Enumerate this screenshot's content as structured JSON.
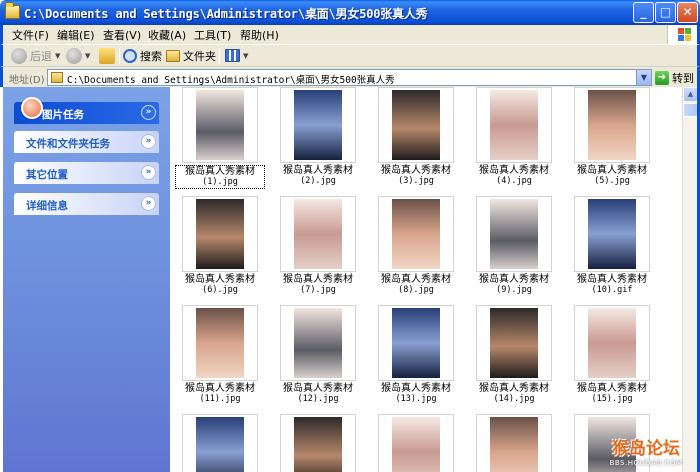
{
  "window": {
    "title": "C:\\Documents and Settings\\Administrator\\桌面\\男女500张真人秀",
    "buttons": {
      "minimize": "_",
      "maximize": "□",
      "close": "✕"
    }
  },
  "menu": [
    "文件(F)",
    "编辑(E)",
    "查看(V)",
    "收藏(A)",
    "工具(T)",
    "帮助(H)"
  ],
  "toolbar": {
    "back": "后退",
    "search": "搜索",
    "folders": "文件夹"
  },
  "address": {
    "label": "地址(D)",
    "value": "C:\\Documents and Settings\\Administrator\\桌面\\男女500张真人秀",
    "go": "转到"
  },
  "tasks": [
    "图片任务",
    "文件和文件夹任务",
    "其它位置",
    "详细信息"
  ],
  "files": [
    {
      "name": "猴岛真人秀素材",
      "ext": "(1).jpg",
      "selected": true
    },
    {
      "name": "猴岛真人秀素材",
      "ext": "(2).jpg"
    },
    {
      "name": "猴岛真人秀素材",
      "ext": "(3).jpg"
    },
    {
      "name": "猴岛真人秀素材",
      "ext": "(4).jpg"
    },
    {
      "name": "猴岛真人秀素材",
      "ext": "(5).jpg"
    },
    {
      "name": "猴岛真人秀素材",
      "ext": "(6).jpg"
    },
    {
      "name": "猴岛真人秀素材",
      "ext": "(7).jpg"
    },
    {
      "name": "猴岛真人秀素材",
      "ext": "(8).jpg"
    },
    {
      "name": "猴岛真人秀素材",
      "ext": "(9).jpg"
    },
    {
      "name": "猴岛真人秀素材",
      "ext": "(10).gif"
    },
    {
      "name": "猴岛真人秀素材",
      "ext": "(11).jpg"
    },
    {
      "name": "猴岛真人秀素材",
      "ext": "(12).jpg"
    },
    {
      "name": "猴岛真人秀素材",
      "ext": "(13).jpg"
    },
    {
      "name": "猴岛真人秀素材",
      "ext": "(14).jpg"
    },
    {
      "name": "猴岛真人秀素材",
      "ext": "(15).jpg"
    },
    {
      "name": "",
      "ext": ""
    },
    {
      "name": "",
      "ext": ""
    },
    {
      "name": "",
      "ext": ""
    },
    {
      "name": "",
      "ext": ""
    },
    {
      "name": "",
      "ext": ""
    }
  ],
  "watermark": {
    "title": "猴岛论坛",
    "sub": "BBS.HOUDAO.COM"
  },
  "colors": {
    "titlebar": "#0a4fd6",
    "panel": "#6d8fdc",
    "task_text": "#215dc6"
  }
}
